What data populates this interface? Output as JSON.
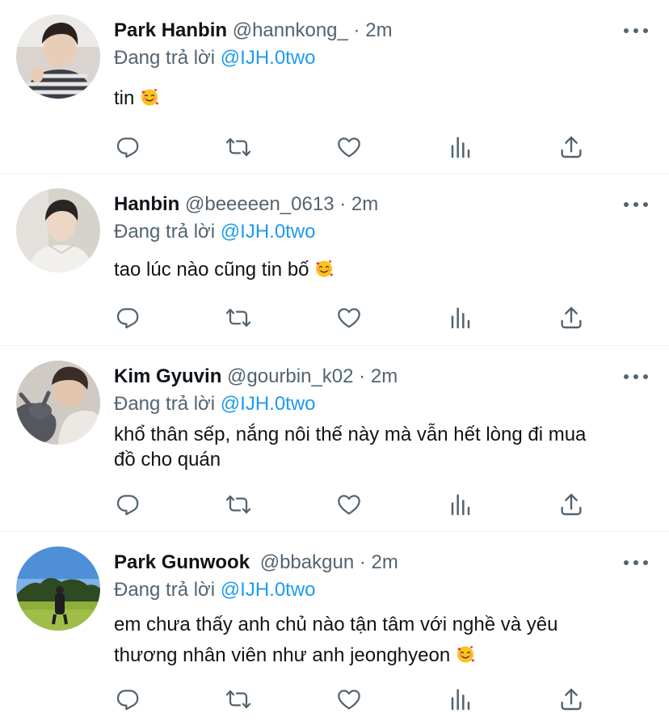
{
  "replying_prefix": "Đang trả lời",
  "colors": {
    "accent": "#1d9bf0",
    "secondary": "#536471",
    "divider": "#eff3f4"
  },
  "tweets": [
    {
      "name": "Park Hanbin",
      "handle": "@hannkong_",
      "dot": "·",
      "time": "2m",
      "mention": "@IJH.0two",
      "line1": "tin",
      "line2": "",
      "emoji": "smiling-face-with-hearts"
    },
    {
      "name": "Hanbin",
      "handle": "@beeeeen_0613",
      "dot": "·",
      "time": "2m",
      "mention": "@IJH.0two",
      "line1": "tao lúc nào cũng tin bố",
      "line2": "",
      "emoji": "smiling-face-with-hearts"
    },
    {
      "name": "Kim Gyuvin",
      "handle": "@gourbin_k02",
      "dot": "·",
      "time": "2m",
      "mention": "@IJH.0two",
      "line1": "khổ thân sếp, nắng nôi thế này mà vẫn hết lòng đi mua",
      "line2": "đồ cho quán",
      "emoji": ""
    },
    {
      "name": "Park Gunwook",
      "handle": "@bbakgun",
      "dot": "·",
      "time": "2m",
      "mention": "@IJH.0two",
      "line1": "em chưa thấy anh chủ nào tận tâm với nghề và yêu",
      "line2": "thương nhân viên như anh jeonghyeon",
      "emoji": "smiling-face-with-hearts"
    }
  ],
  "action_icons": [
    "reply-icon",
    "retweet-icon",
    "like-icon",
    "analytics-icon",
    "share-icon"
  ]
}
